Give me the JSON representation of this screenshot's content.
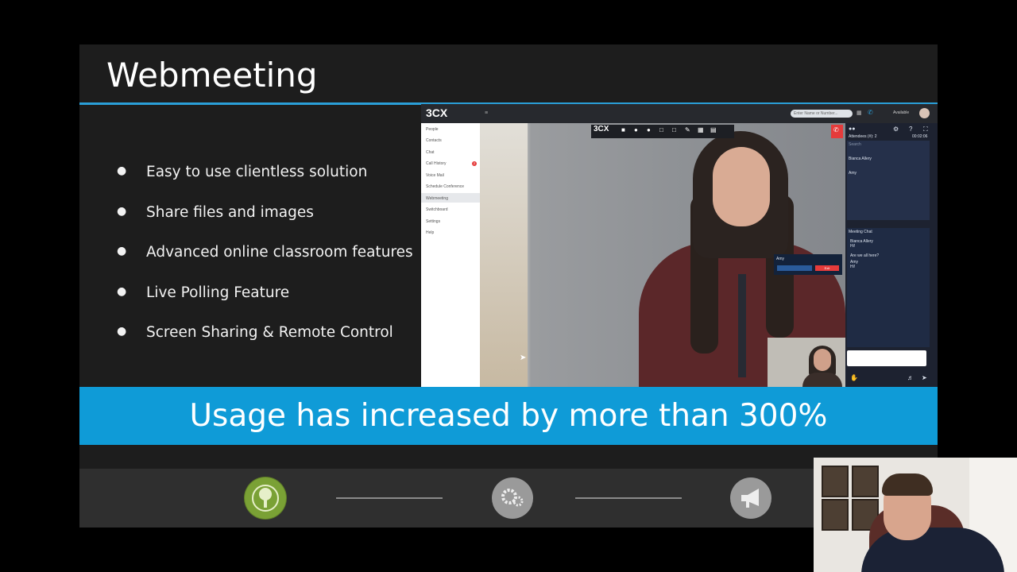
{
  "slide": {
    "title": "Webmeeting",
    "bullets": [
      "Easy to use clientless solution",
      "Share files and images",
      "Advanced online classroom features",
      "Live Polling Feature",
      "Screen Sharing & Remote Control"
    ],
    "banner": "Usage has increased by more than 300%"
  },
  "app": {
    "logo": "3CX",
    "search_placeholder": "Enter Name or Number...",
    "status": "Available",
    "sidebar": [
      "People",
      "Contacts",
      "Chat",
      "Call History",
      "Voice Mail",
      "Schedule Conference",
      "Webmeeting",
      "Switchboard",
      "Settings",
      "Help"
    ],
    "call_history_badge": "2",
    "video_logo": "3CX",
    "attendees_label": "Attendees (#): 2",
    "timer": "00:02:06",
    "search_label": "Search",
    "attendees": [
      "Bianca Allery",
      "Amy"
    ],
    "chat_title": "Meeting Chat",
    "chat": [
      {
        "name": "Bianca Allery",
        "text": "Hi!"
      },
      {
        "name": "",
        "text": "Are we all here?"
      },
      {
        "name": "Amy",
        "text": "Hi!"
      }
    ],
    "mini_card_name": "Amy",
    "mini_card_btn": "Exit"
  },
  "footer": {
    "icons": [
      "globe-tree-icon",
      "gears-icon",
      "megaphone-icon"
    ],
    "colors": {
      "left": "#7aa135",
      "middle": "#9a9a9a",
      "right": "#9a9a9a"
    }
  },
  "colors": {
    "accent": "#0f9bd7",
    "title_rule": "#2a9fd8",
    "slide_bg": "#1d1d1d"
  }
}
